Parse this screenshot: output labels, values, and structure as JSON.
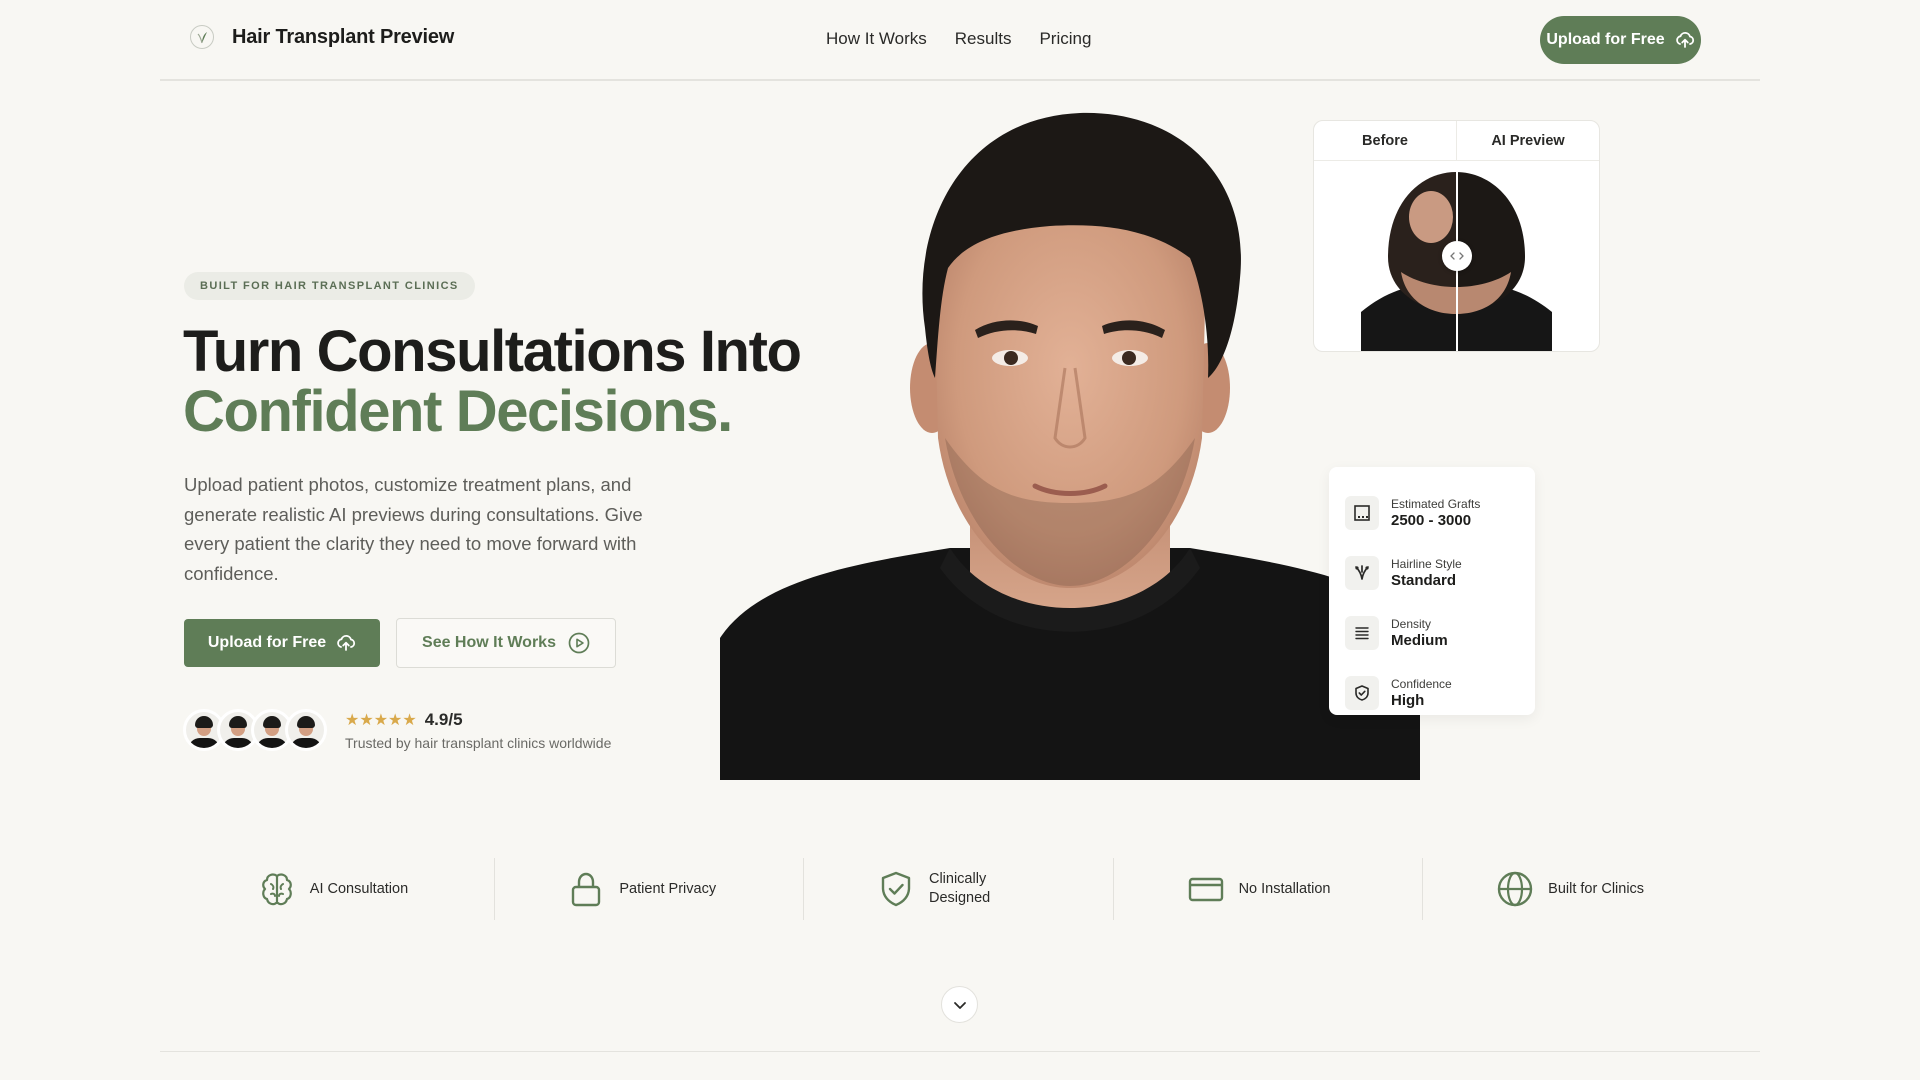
{
  "nav": {
    "brand": "Hair Transplant Preview",
    "links": [
      "How It Works",
      "Results",
      "Pricing"
    ],
    "cta": "Upload for Free"
  },
  "hero": {
    "badge": "BUILT FOR HAIR TRANSPLANT CLINICS",
    "headline_line1": "Turn Consultations Into",
    "headline_line2": "Confident Decisions.",
    "lead": "Upload patient photos, customize treatment plans, and generate realistic AI previews during consultations. Give every patient the clarity they need to move forward with confidence.",
    "primary_cta": "Upload for Free",
    "secondary_cta": "See How It Works",
    "stars": "★★★★★",
    "rating": "4.9/5",
    "trust_text": "Trusted by hair transplant clinics worldwide"
  },
  "comparison": {
    "before_label": "Before",
    "after_label": "AI Preview"
  },
  "stats": [
    {
      "label": "Estimated Grafts",
      "value": "2500 - 3000",
      "icon": "grafts-icon"
    },
    {
      "label": "Hairline Style",
      "value": "Standard",
      "icon": "hairline-icon"
    },
    {
      "label": "Density",
      "value": "Medium",
      "icon": "density-icon"
    },
    {
      "label": "Confidence",
      "value": "High",
      "icon": "shield-check-icon"
    }
  ],
  "features": [
    {
      "label": "AI Consultation",
      "icon": "brain-icon"
    },
    {
      "label": "Patient Privacy",
      "icon": "lock-icon"
    },
    {
      "label": "Clinically Designed",
      "icon": "shield-check-icon"
    },
    {
      "label": "No Installation",
      "icon": "card-icon"
    },
    {
      "label": "Built for Clinics",
      "icon": "globe-icon"
    }
  ],
  "colors": {
    "accent": "#5f7d57",
    "background": "#f8f7f3",
    "star": "#d9a94b"
  }
}
